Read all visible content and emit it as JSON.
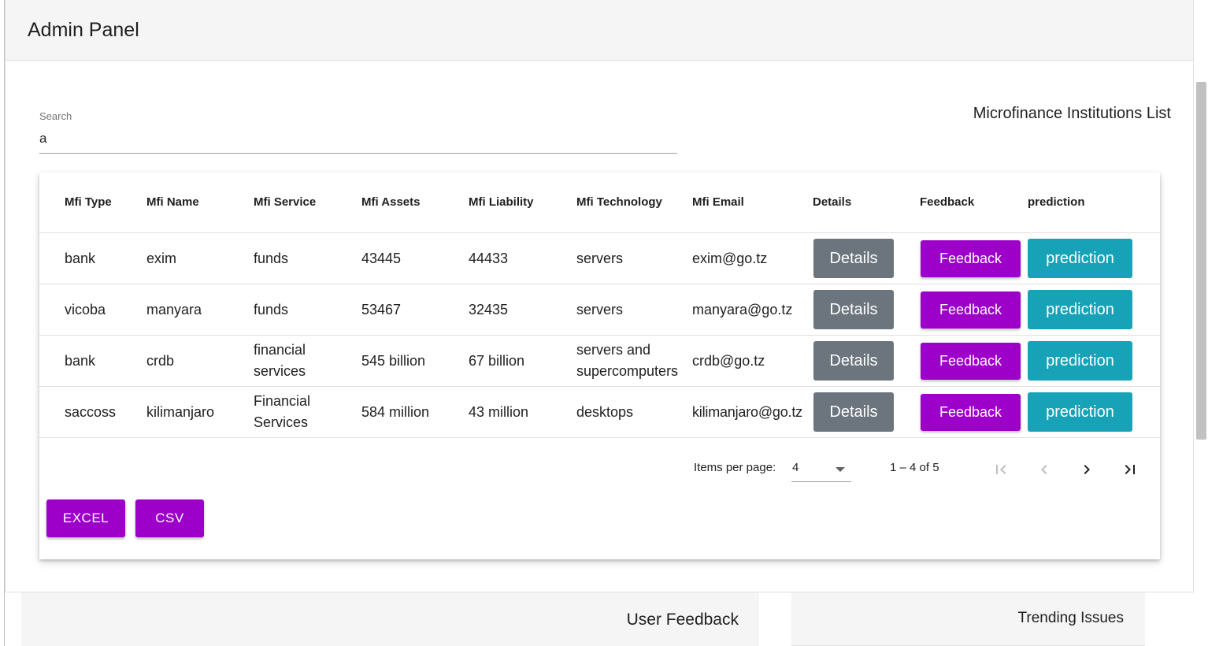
{
  "header": {
    "title": "Admin Panel"
  },
  "search": {
    "label": "Search",
    "value": "a"
  },
  "list_title": "Microfinance Institutions List",
  "table": {
    "columns": [
      "Mfi Type",
      "Mfi Name",
      "Mfi Service",
      "Mfi Assets",
      "Mfi Liability",
      "Mfi Technology",
      "Mfi Email",
      "Details",
      "Feedback",
      "prediction"
    ],
    "rows": [
      {
        "type": "bank",
        "name": "exim",
        "service": [
          "funds"
        ],
        "assets": "43445",
        "liability": "44433",
        "technology": [
          "servers"
        ],
        "email": "exim@go.tz"
      },
      {
        "type": "vicoba",
        "name": "manyara",
        "service": [
          "funds"
        ],
        "assets": "53467",
        "liability": "32435",
        "technology": [
          "servers"
        ],
        "email": "manyara@go.tz"
      },
      {
        "type": "bank",
        "name": "crdb",
        "service": [
          "financial",
          "services"
        ],
        "assets": "545 billion",
        "liability": "67 billion",
        "technology": [
          "servers and",
          "supercomputers"
        ],
        "email": "crdb@go.tz"
      },
      {
        "type": "saccoss",
        "name": "kilimanjaro",
        "service": [
          "Financial",
          "Services"
        ],
        "assets": "584 million",
        "liability": "43 million",
        "technology": [
          "desktops"
        ],
        "email": "kilimanjaro@go.tz"
      }
    ],
    "buttons": {
      "details": "Details",
      "feedback": "Feedback",
      "prediction": "prediction"
    }
  },
  "paginator": {
    "items_per_page_label": "Items per page:",
    "page_size": "4",
    "range": "1 – 4 of 5"
  },
  "export": {
    "excel": "EXCEL",
    "csv": "CSV"
  },
  "bottom": {
    "user_feedback": "User Feedback",
    "trending_issues": "Trending Issues"
  },
  "colors": {
    "feedback": "#9c00c9",
    "details": "#6c757d",
    "prediction": "#17a2b8"
  },
  "icons": {
    "first": "first-page-icon",
    "prev": "chevron-left-icon",
    "next": "chevron-right-icon",
    "last": "last-page-icon",
    "dropdown": "caret-down-icon"
  }
}
